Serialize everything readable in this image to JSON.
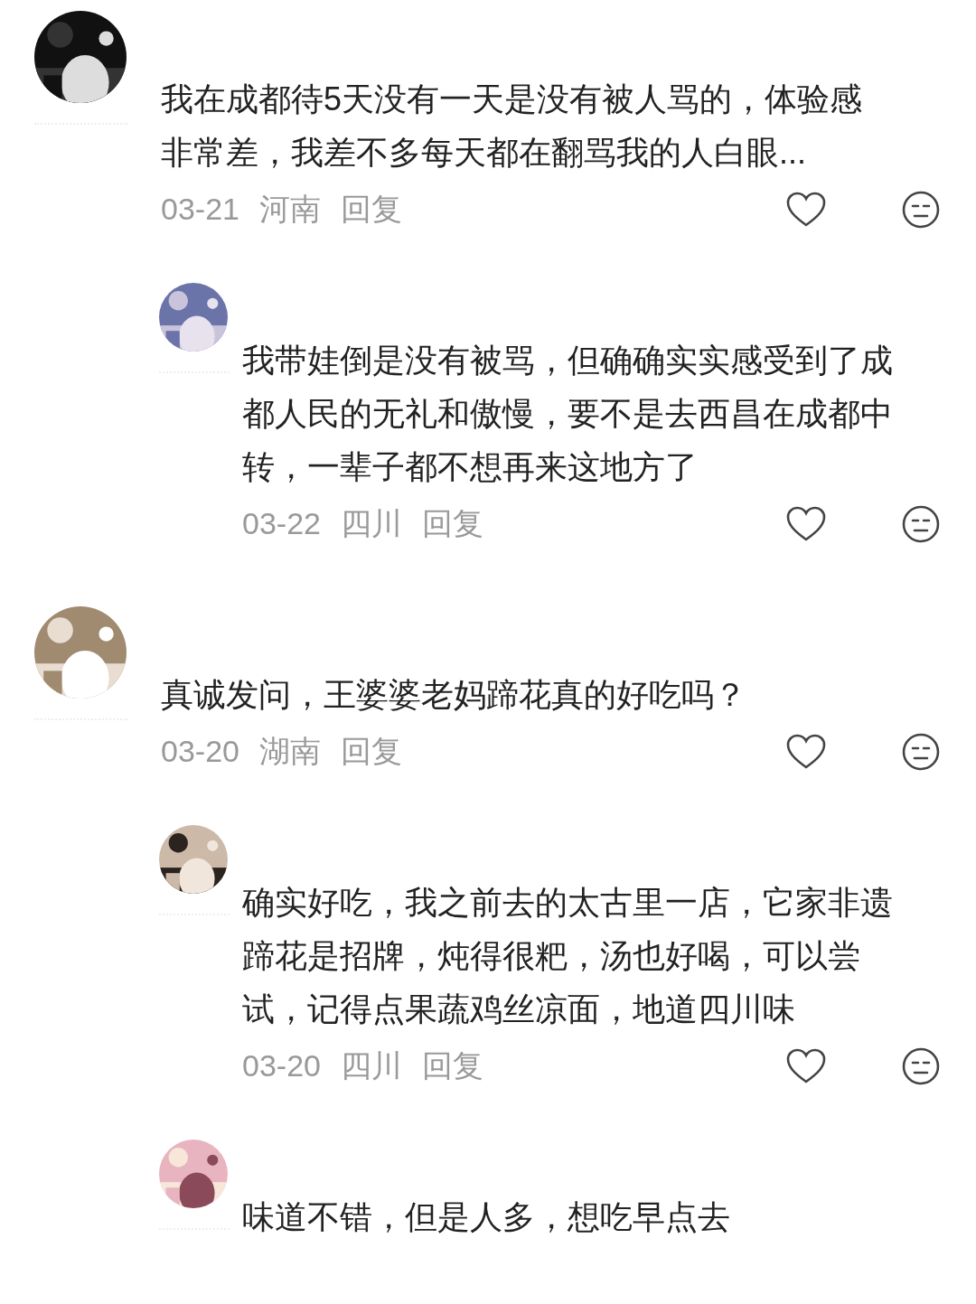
{
  "comments": [
    {
      "text": "我在成都待5天没有一天是没有被人骂的，体验感非常差，我差不多每天都在翻骂我的人白眼...",
      "date": "03-21",
      "region": "河南",
      "reply_label": "回复",
      "replies": [
        {
          "text": "我带娃倒是没有被骂，但确确实实感受到了成都人民的无礼和傲慢，要不是去西昌在成都中转，一辈子都不想再来这地方了",
          "date": "03-22",
          "region": "四川",
          "reply_label": "回复"
        }
      ]
    },
    {
      "text": "真诚发问，王婆婆老妈蹄花真的好吃吗？",
      "date": "03-20",
      "region": "湖南",
      "reply_label": "回复",
      "replies": [
        {
          "text": "确实好吃，我之前去的太古里一店，它家非遗蹄花是招牌，炖得很粑，汤也好喝，可以尝试，记得点果蔬鸡丝凉面，地道四川味",
          "date": "03-20",
          "region": "四川",
          "reply_label": "回复"
        },
        {
          "text": "味道不错，但是人多，想吃早点去"
        }
      ]
    }
  ]
}
